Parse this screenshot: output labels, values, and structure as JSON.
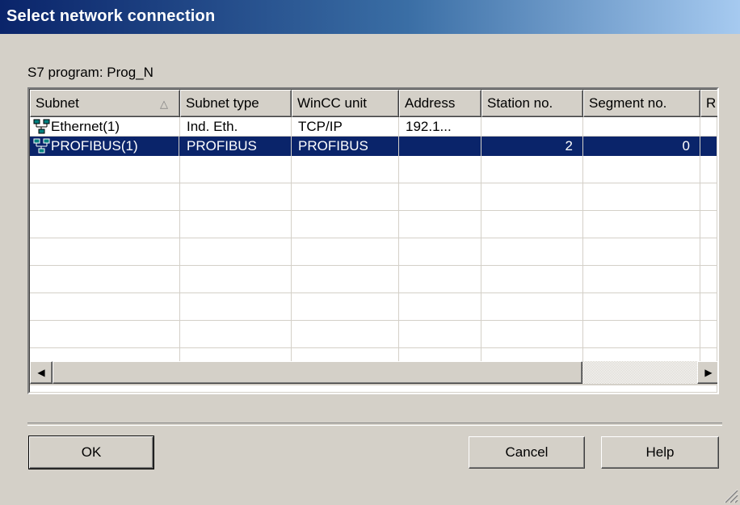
{
  "window": {
    "title": "Select network connection"
  },
  "program_label": "S7 program: Prog_N",
  "table": {
    "columns": [
      "Subnet",
      "Subnet type",
      "WinCC unit",
      "Address",
      "Station no.",
      "Segment no.",
      "R"
    ],
    "sorted_column": "Subnet",
    "rows": [
      {
        "subnet": "Ethernet(1)",
        "subnet_type": "Ind. Eth.",
        "wincc_unit": "TCP/IP",
        "address": "192.1...",
        "station_no": "",
        "segment_no": "",
        "selected": false
      },
      {
        "subnet": "PROFIBUS(1)",
        "subnet_type": "PROFIBUS",
        "wincc_unit": "PROFIBUS",
        "address": "",
        "station_no": "2",
        "segment_no": "0",
        "selected": true
      }
    ]
  },
  "buttons": {
    "ok": "OK",
    "cancel": "Cancel",
    "help": "Help"
  },
  "colors": {
    "selection": "#0a246a",
    "face": "#d4d0c8",
    "title_start": "#0a246a",
    "title_end": "#a6caf0"
  },
  "icons": [
    "network-icon",
    "sort-up-icon",
    "scroll-left-icon",
    "scroll-right-icon",
    "resize-grip-icon"
  ]
}
